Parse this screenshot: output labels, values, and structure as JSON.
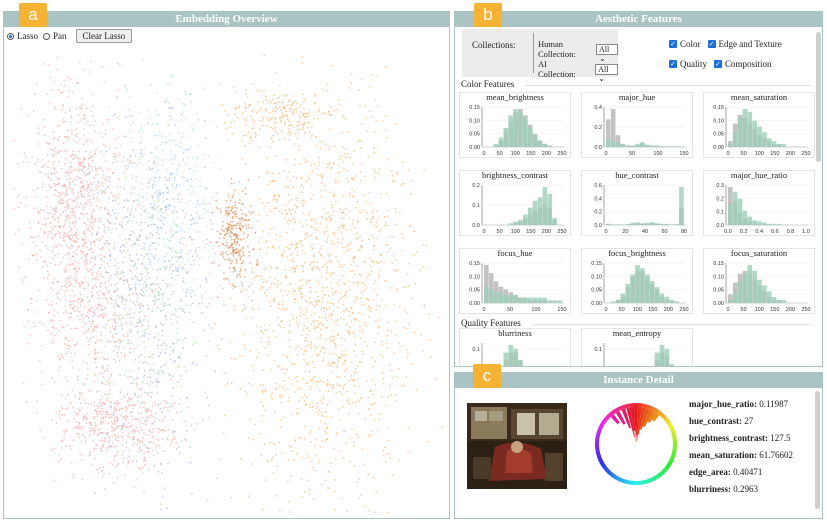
{
  "badges": {
    "a": "a",
    "b": "b",
    "c": "c"
  },
  "embedding": {
    "title": "Embedding Overview",
    "lasso_label": "Lasso",
    "pan_label": "Pan",
    "clear_button": "Clear Lasso"
  },
  "aesthetic": {
    "title": "Aesthetic Features",
    "collections_label": "Collections:",
    "human_collection_label": "Human Collection:",
    "human_collection_value": "All",
    "ai_collection_label": "AI Collection:",
    "ai_collection_value": "All",
    "checks": {
      "color": "Color",
      "edge": "Edge and Texture",
      "quality": "Quality",
      "composition": "Composition"
    },
    "color_features_title": "Color Features",
    "quality_features_title": "Quality Features"
  },
  "histograms": [
    {
      "title": "mean_brightness",
      "yticks": [
        "0.15",
        "0.10",
        "0.05",
        "0.00"
      ],
      "xticks": [
        "0",
        "50",
        "100",
        "150",
        "200",
        "250"
      ],
      "green": [
        0,
        0,
        0.01,
        0.03,
        0.06,
        0.1,
        0.12,
        0.11,
        0.09,
        0.06,
        0.04,
        0.02,
        0.01,
        0.005,
        0,
        0
      ],
      "gray": [
        0,
        0,
        0.005,
        0.02,
        0.05,
        0.08,
        0.11,
        0.12,
        0.1,
        0.07,
        0.04,
        0.02,
        0.01,
        0,
        0,
        0
      ]
    },
    {
      "title": "major_hue",
      "yticks": [
        "0.4",
        "0.2",
        "0.0"
      ],
      "xticks": [
        "0",
        "50",
        "100",
        "150"
      ],
      "green": [
        0.1,
        0.08,
        0.05,
        0.03,
        0.02,
        0.02,
        0.04,
        0.06,
        0.03,
        0.02,
        0.02,
        0.01,
        0.01,
        0.01,
        0.01,
        0.005
      ],
      "gray": [
        0.35,
        0.48,
        0.15,
        0.04,
        0.02,
        0.01,
        0.02,
        0.05,
        0.02,
        0.01,
        0.01,
        0.01,
        0,
        0,
        0,
        0
      ]
    },
    {
      "title": "mean_saturation",
      "yticks": [
        "0.15",
        "0.10",
        "0.05",
        "0.00"
      ],
      "xticks": [
        "0",
        "50",
        "100",
        "150",
        "200",
        "250"
      ],
      "green": [
        0.01,
        0.05,
        0.1,
        0.13,
        0.12,
        0.09,
        0.07,
        0.05,
        0.03,
        0.02,
        0.01,
        0.01,
        0,
        0,
        0,
        0
      ],
      "gray": [
        0.02,
        0.08,
        0.11,
        0.1,
        0.08,
        0.06,
        0.04,
        0.03,
        0.02,
        0.01,
        0.01,
        0,
        0,
        0,
        0,
        0
      ]
    },
    {
      "title": "brightness_contrast",
      "yticks": [
        "0.2",
        "0.1",
        "0.0"
      ],
      "xticks": [
        "0",
        "50",
        "100",
        "150",
        "200",
        "250"
      ],
      "green": [
        0,
        0,
        0,
        0,
        0,
        0.01,
        0.02,
        0.03,
        0.06,
        0.1,
        0.14,
        0.16,
        0.22,
        0.18,
        0.04,
        0
      ],
      "gray": [
        0,
        0,
        0,
        0,
        0,
        0,
        0.01,
        0.02,
        0.04,
        0.06,
        0.08,
        0.1,
        0.12,
        0.1,
        0.03,
        0
      ]
    },
    {
      "title": "hue_contrast",
      "yticks": [
        "0.6",
        "0.4",
        "0.2",
        "0.0"
      ],
      "xticks": [
        "0",
        "20",
        "40",
        "60",
        "80"
      ],
      "green": [
        0.02,
        0.01,
        0.01,
        0.01,
        0.02,
        0.04,
        0.05,
        0.03,
        0.04,
        0.05,
        0.03,
        0.02,
        0.02,
        0.01,
        0.02,
        0.68
      ],
      "gray": [
        0.02,
        0.01,
        0.01,
        0,
        0.01,
        0.02,
        0.03,
        0.02,
        0.02,
        0.03,
        0.02,
        0.01,
        0.01,
        0.01,
        0.01,
        0.3
      ]
    },
    {
      "title": "major_hue_ratio",
      "yticks": [
        "0.3",
        "0.2",
        "0.1",
        "0.0"
      ],
      "xticks": [
        "0.0",
        "0.2",
        "0.4",
        "0.6",
        "0.8",
        "1.0"
      ],
      "green": [
        0.18,
        0.28,
        0.22,
        0.12,
        0.07,
        0.04,
        0.03,
        0.02,
        0.01,
        0.01,
        0.01,
        0,
        0,
        0,
        0,
        0
      ],
      "gray": [
        0.32,
        0.2,
        0.1,
        0.05,
        0.03,
        0.02,
        0.01,
        0.01,
        0,
        0,
        0,
        0,
        0,
        0,
        0,
        0
      ]
    },
    {
      "title": "focus_hue",
      "yticks": [
        "0.15",
        "0.10",
        "0.05",
        "0.00"
      ],
      "xticks": [
        "0",
        "50",
        "100",
        "150"
      ],
      "green": [
        0.06,
        0.05,
        0.04,
        0.04,
        0.03,
        0.03,
        0.03,
        0.02,
        0.02,
        0.02,
        0.02,
        0.02,
        0.02,
        0.01,
        0.01,
        0.01
      ],
      "gray": [
        0.14,
        0.11,
        0.08,
        0.06,
        0.05,
        0.04,
        0.03,
        0.02,
        0.02,
        0.01,
        0.01,
        0.01,
        0.01,
        0,
        0,
        0
      ]
    },
    {
      "title": "focus_brightness",
      "yticks": [
        "0.15",
        "0.10",
        "0.05",
        "0.00"
      ],
      "xticks": [
        "0",
        "50",
        "100",
        "150",
        "200",
        "250"
      ],
      "green": [
        0,
        0.005,
        0.01,
        0.03,
        0.06,
        0.09,
        0.12,
        0.11,
        0.09,
        0.07,
        0.05,
        0.03,
        0.02,
        0.01,
        0.005,
        0
      ],
      "gray": [
        0,
        0,
        0.01,
        0.02,
        0.05,
        0.08,
        0.1,
        0.1,
        0.08,
        0.06,
        0.04,
        0.02,
        0.01,
        0.005,
        0,
        0
      ]
    },
    {
      "title": "focus_saturation",
      "yticks": [
        "0.15",
        "0.10",
        "0.05",
        "0.00"
      ],
      "xticks": [
        "0",
        "50",
        "100",
        "150",
        "200",
        "250"
      ],
      "green": [
        0.01,
        0.03,
        0.07,
        0.1,
        0.13,
        0.11,
        0.08,
        0.06,
        0.04,
        0.02,
        0.01,
        0.01,
        0,
        0,
        0,
        0
      ],
      "gray": [
        0.03,
        0.07,
        0.1,
        0.11,
        0.1,
        0.08,
        0.06,
        0.04,
        0.02,
        0.01,
        0.01,
        0,
        0,
        0,
        0,
        0
      ]
    },
    {
      "title": "blurriness",
      "yticks": [
        "0.1"
      ],
      "xticks": [],
      "green": [
        0,
        0.01,
        0.02,
        0.04,
        0.08,
        0.1,
        0.09,
        0.06,
        0.04,
        0.02,
        0.01,
        0,
        0,
        0,
        0,
        0
      ],
      "gray": [
        0,
        0.01,
        0.02,
        0.03,
        0.06,
        0.08,
        0.08,
        0.06,
        0.03,
        0.02,
        0.01,
        0,
        0,
        0,
        0,
        0
      ]
    },
    {
      "title": "mean_entropy",
      "yticks": [
        "0.1"
      ],
      "xticks": [],
      "green": [
        0,
        0,
        0,
        0,
        0,
        0,
        0,
        0.01,
        0.02,
        0.04,
        0.08,
        0.1,
        0.09,
        0.05,
        0.02,
        0
      ],
      "gray": [
        0,
        0,
        0,
        0,
        0,
        0,
        0,
        0.01,
        0.02,
        0.03,
        0.06,
        0.08,
        0.07,
        0.04,
        0.02,
        0
      ]
    }
  ],
  "instance": {
    "title": "Instance Detail",
    "rows": [
      {
        "key": "major_hue_ratio:",
        "value": "0.11987"
      },
      {
        "key": "hue_contrast:",
        "value": "27"
      },
      {
        "key": "brightness_contrast:",
        "value": "127.5"
      },
      {
        "key": "mean_saturation:",
        "value": "61.76602"
      },
      {
        "key": "edge_area:",
        "value": "0.40471"
      },
      {
        "key": "blurriness:",
        "value": "0.2963"
      }
    ]
  },
  "colors": {
    "panel_border": "#a9c4c2",
    "badge": "#f6b233",
    "hist_green": "#9ecdb8",
    "hist_gray": "#b9b9b9",
    "human": "#f0a7a3",
    "ai": "#f4b46a",
    "ai_dark": "#e2844a",
    "blue": "#9db3db",
    "green": "#b6dca8",
    "cyan": "#a9d8e6"
  }
}
